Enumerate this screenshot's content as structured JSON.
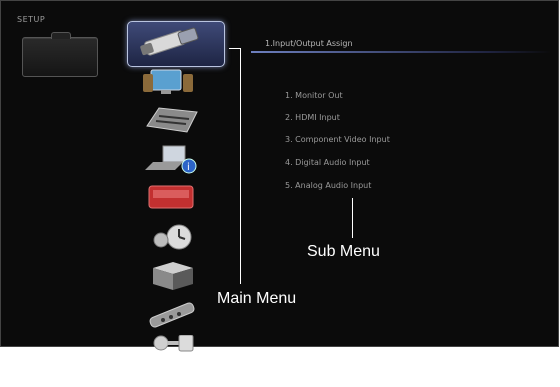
{
  "screen": {
    "setup_label": "SETUP"
  },
  "main_menu": {
    "items": [
      {
        "icon": "hdmi-cable-icon",
        "selected": true
      },
      {
        "icon": "video-output-icon",
        "selected": false
      },
      {
        "icon": "audio-device-icon",
        "selected": false
      },
      {
        "icon": "network-info-icon",
        "selected": false
      },
      {
        "icon": "display-panel-icon",
        "selected": false
      },
      {
        "icon": "timer-icon",
        "selected": false
      },
      {
        "icon": "cube-box-icon",
        "selected": false
      },
      {
        "icon": "remote-control-icon",
        "selected": false
      },
      {
        "icon": "lock-key-icon",
        "selected": false
      }
    ]
  },
  "sub_menu": {
    "title": "1.Input/Output Assign",
    "items": [
      "1.  Monitor Out",
      "2.  HDMI Input",
      "3.  Component Video Input",
      "4.  Digital Audio Input",
      "5.  Analog Audio Input"
    ]
  },
  "callouts": {
    "sub_menu": "Sub Menu",
    "main_menu": "Main Menu"
  }
}
